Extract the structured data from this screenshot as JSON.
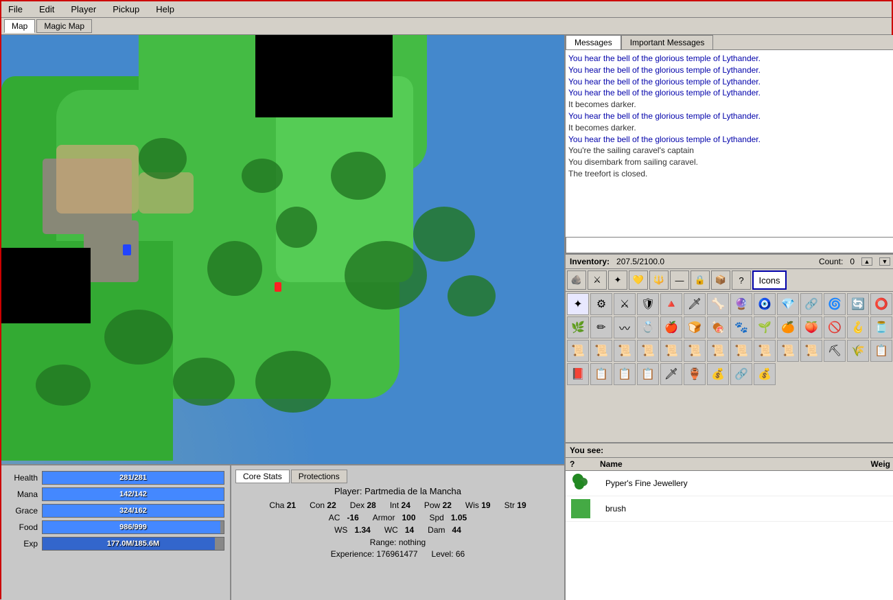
{
  "menu": {
    "items": [
      "File",
      "Edit",
      "Player",
      "Pickup",
      "Help"
    ]
  },
  "map_tabs": [
    {
      "label": "Map",
      "active": true
    },
    {
      "label": "Magic Map",
      "active": false
    }
  ],
  "messages": {
    "tabs": [
      {
        "label": "Messages",
        "active": true
      },
      {
        "label": "Important Messages",
        "active": false
      }
    ],
    "lines": [
      "You hear the bell of the glorious temple of Lythander.",
      "You hear the bell of the glorious temple of Lythander.",
      "You hear the bell of the glorious temple of Lythander.",
      "You hear the bell of the glorious temple of Lythander.",
      "It becomes darker.",
      "You hear the bell of the glorious temple of Lythander.",
      "It becomes darker.",
      "You hear the bell of the glorious temple of Lythander.",
      "You're the sailing caravel's captain",
      "You disembark from sailing caravel.",
      "The treefort is closed."
    ]
  },
  "inventory": {
    "label": "Inventory:",
    "weight": "207.5/2100.0",
    "count_label": "Count:",
    "count_value": "0",
    "toolbar_icons": [
      "🪨",
      "⚔",
      "🔮",
      "💛",
      "🔱",
      "➖",
      "🔒",
      "📦",
      "❓",
      "Icons"
    ]
  },
  "vital_stats": {
    "health": {
      "label": "Health",
      "current": 281,
      "max": 281,
      "text": "281/281",
      "pct": 100
    },
    "mana": {
      "label": "Mana",
      "current": 142,
      "max": 142,
      "text": "142/142",
      "pct": 100
    },
    "grace": {
      "label": "Grace",
      "current": 324,
      "max": 162,
      "text": "324/162",
      "pct": 100
    },
    "food": {
      "label": "Food",
      "current": 986,
      "max": 999,
      "text": "986/999",
      "pct": 98
    },
    "exp": {
      "label": "Exp",
      "current": 177.0,
      "max": 185.6,
      "text": "177.0M/185.6M",
      "pct": 95
    }
  },
  "char_tabs": [
    {
      "label": "Core Stats",
      "active": true
    },
    {
      "label": "Protections",
      "active": false
    }
  ],
  "char_info": {
    "player_name": "Player: Partmedia de la Mancha",
    "attributes": [
      {
        "key": "Cha",
        "val": "21"
      },
      {
        "key": "Con",
        "val": "22"
      },
      {
        "key": "Dex",
        "val": "28"
      },
      {
        "key": "Int",
        "val": "24"
      },
      {
        "key": "Pow",
        "val": "22"
      },
      {
        "key": "Wis",
        "val": "19"
      },
      {
        "key": "Str",
        "val": "19"
      }
    ],
    "combat_stats": [
      {
        "key": "AC",
        "val": "-16"
      },
      {
        "key": "Armor",
        "val": "100"
      },
      {
        "key": "Spd",
        "val": "1.05"
      },
      {
        "key": "WS",
        "val": "1.34"
      },
      {
        "key": "WC",
        "val": "14"
      },
      {
        "key": "Dam",
        "val": "44"
      }
    ],
    "range": "Range: nothing",
    "experience": "Experience: 176961477",
    "level": "Level: 66"
  },
  "you_see": {
    "header": "You see:",
    "columns": [
      "?",
      "Name",
      "Weig"
    ],
    "items": [
      {
        "icon": "💎",
        "name": "Pyper's Fine Jewellery",
        "weight": "",
        "color": "green"
      },
      {
        "icon": "🟩",
        "name": "brush",
        "weight": "",
        "color": "green"
      }
    ]
  }
}
